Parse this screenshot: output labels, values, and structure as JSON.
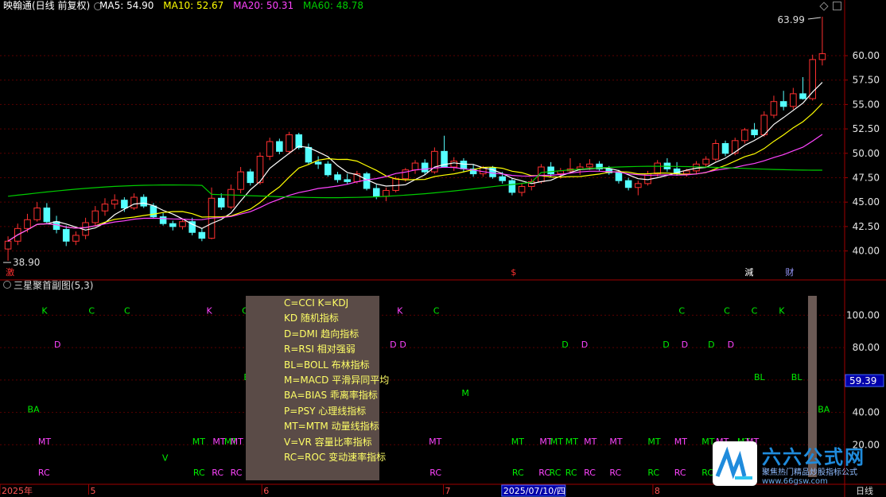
{
  "header": {
    "title": "映翰通(日线 前复权)",
    "ma5": "MA5: 54.90",
    "ma10": "MA10: 52.67",
    "ma20": "MA20: 50.31",
    "ma60": "MA60: 48.78"
  },
  "colors": {
    "up": "#ff3030",
    "down": "#55ffff",
    "ma5": "#ffffff",
    "ma10": "#ffff00",
    "ma20": "#ff44ff",
    "ma60": "#00cc00",
    "grid": "#5a0000",
    "axis": "#a00000",
    "signal_green": "#00ee00",
    "signal_magenta": "#ff44ff"
  },
  "sub_panel": {
    "title": "三星聚首副图(5,3)"
  },
  "chart_data": {
    "type": "candlestick",
    "main_axis": {
      "ticks": [
        "60.00",
        "57.50",
        "55.00",
        "52.50",
        "50.00",
        "47.50",
        "45.00",
        "42.50",
        "40.00"
      ],
      "ylim": [
        38.5,
        63.99
      ]
    },
    "sub_axis": {
      "ticks": [
        "100.00",
        "80.00",
        "60.00",
        "40.00",
        "20.00"
      ],
      "current_value": "59.39"
    },
    "high_marker": "63.99",
    "low_marker": "38.90",
    "x_labels": [
      {
        "label": "2025年",
        "pos": 0.0
      },
      {
        "label": "5",
        "pos": 0.105
      },
      {
        "label": "6",
        "pos": 0.31
      },
      {
        "label": "7",
        "pos": 0.525
      },
      {
        "label": "2025/07/10/四",
        "pos": 0.594,
        "highlight": true
      },
      {
        "label": "8",
        "pos": 0.773
      }
    ],
    "x_axis_right_label": "日线",
    "event_marks": [
      {
        "label": "激",
        "pos": 0.003,
        "color": "#ff3030"
      },
      {
        "label": "$",
        "pos": 0.601,
        "color": "#ff3030"
      },
      {
        "label": "減",
        "pos": 0.878,
        "color": "#ffffff"
      },
      {
        "label": "财",
        "pos": 0.926,
        "color": "#9999ff"
      }
    ],
    "candles": [
      [
        40.2,
        41.5,
        39.0,
        41.0
      ],
      [
        41.0,
        42.8,
        40.6,
        42.3
      ],
      [
        42.3,
        43.8,
        41.9,
        43.2
      ],
      [
        43.2,
        45.0,
        43.0,
        44.4
      ],
      [
        44.4,
        44.9,
        42.8,
        43.0
      ],
      [
        43.0,
        43.6,
        41.8,
        42.2
      ],
      [
        42.2,
        42.6,
        40.5,
        41.0
      ],
      [
        41.0,
        42.0,
        40.6,
        41.6
      ],
      [
        41.6,
        43.4,
        41.2,
        42.9
      ],
      [
        42.9,
        44.6,
        42.6,
        44.1
      ],
      [
        44.1,
        45.4,
        43.6,
        44.8
      ],
      [
        44.8,
        45.8,
        44.3,
        45.2
      ],
      [
        45.2,
        45.5,
        44.0,
        44.4
      ],
      [
        44.4,
        45.9,
        44.2,
        45.5
      ],
      [
        45.5,
        45.8,
        44.4,
        44.6
      ],
      [
        44.6,
        44.9,
        43.3,
        43.5
      ],
      [
        43.5,
        43.9,
        42.6,
        42.8
      ],
      [
        42.8,
        43.1,
        42.1,
        42.5
      ],
      [
        42.5,
        43.3,
        42.2,
        43.0
      ],
      [
        43.0,
        43.4,
        41.6,
        41.9
      ],
      [
        41.9,
        42.3,
        41.0,
        41.3
      ],
      [
        41.3,
        46.5,
        41.2,
        45.4
      ],
      [
        45.4,
        45.9,
        44.2,
        44.5
      ],
      [
        44.5,
        46.8,
        44.3,
        46.3
      ],
      [
        46.3,
        48.6,
        45.9,
        48.1
      ],
      [
        48.1,
        48.4,
        46.7,
        47.0
      ],
      [
        47.0,
        50.1,
        46.8,
        49.7
      ],
      [
        49.7,
        51.6,
        49.3,
        51.2
      ],
      [
        51.2,
        51.5,
        49.9,
        50.2
      ],
      [
        50.2,
        52.2,
        49.9,
        51.9
      ],
      [
        51.9,
        52.1,
        50.4,
        50.6
      ],
      [
        50.6,
        51.0,
        48.8,
        49.1
      ],
      [
        49.1,
        49.7,
        48.4,
        48.9
      ],
      [
        48.9,
        49.2,
        47.6,
        47.8
      ],
      [
        47.8,
        48.1,
        47.0,
        47.3
      ],
      [
        47.3,
        47.9,
        46.8,
        47.1
      ],
      [
        47.1,
        48.2,
        46.9,
        47.9
      ],
      [
        47.9,
        48.1,
        46.2,
        46.4
      ],
      [
        46.4,
        46.8,
        45.3,
        45.6
      ],
      [
        45.6,
        46.5,
        45.1,
        46.2
      ],
      [
        46.2,
        47.6,
        46.0,
        47.4
      ],
      [
        47.4,
        48.5,
        47.1,
        48.3
      ],
      [
        48.3,
        49.3,
        47.9,
        49.0
      ],
      [
        49.0,
        49.4,
        47.8,
        48.1
      ],
      [
        48.1,
        50.6,
        47.9,
        50.2
      ],
      [
        50.2,
        51.8,
        49.9,
        48.6
      ],
      [
        48.6,
        49.6,
        48.2,
        49.2
      ],
      [
        49.2,
        49.5,
        48.1,
        48.4
      ],
      [
        48.4,
        48.9,
        47.6,
        47.9
      ],
      [
        47.9,
        48.7,
        47.6,
        48.5
      ],
      [
        48.5,
        48.7,
        47.4,
        47.6
      ],
      [
        47.6,
        48.1,
        46.9,
        47.2
      ],
      [
        47.2,
        47.5,
        45.7,
        46.0
      ],
      [
        46.0,
        46.9,
        45.6,
        46.6
      ],
      [
        46.6,
        47.4,
        46.2,
        47.1
      ],
      [
        47.1,
        48.9,
        46.9,
        48.6
      ],
      [
        48.6,
        49.1,
        47.6,
        47.9
      ],
      [
        47.9,
        48.5,
        47.4,
        48.2
      ],
      [
        48.2,
        49.5,
        47.9,
        48.4
      ],
      [
        48.4,
        49.0,
        47.8,
        48.6
      ],
      [
        48.6,
        49.4,
        48.3,
        48.9
      ],
      [
        48.9,
        49.2,
        48.2,
        48.4
      ],
      [
        48.4,
        48.7,
        47.8,
        48.0
      ],
      [
        48.0,
        48.3,
        46.9,
        47.2
      ],
      [
        47.2,
        47.5,
        46.2,
        46.5
      ],
      [
        46.5,
        47.2,
        45.7,
        46.9
      ],
      [
        46.9,
        48.2,
        46.7,
        47.9
      ],
      [
        47.9,
        49.3,
        47.6,
        49.0
      ],
      [
        49.0,
        49.5,
        48.1,
        48.4
      ],
      [
        48.4,
        49.1,
        47.7,
        47.9
      ],
      [
        47.9,
        48.4,
        47.6,
        48.2
      ],
      [
        48.2,
        49.2,
        47.9,
        48.9
      ],
      [
        48.9,
        49.7,
        48.6,
        49.4
      ],
      [
        49.4,
        51.4,
        49.2,
        51.0
      ],
      [
        51.0,
        51.3,
        49.7,
        50.0
      ],
      [
        50.0,
        51.6,
        49.8,
        51.3
      ],
      [
        51.3,
        52.6,
        51.0,
        52.4
      ],
      [
        52.4,
        53.1,
        51.6,
        51.9
      ],
      [
        51.9,
        54.3,
        51.7,
        53.9
      ],
      [
        53.9,
        55.9,
        53.6,
        55.3
      ],
      [
        55.3,
        56.4,
        54.4,
        54.8
      ],
      [
        54.8,
        56.7,
        54.5,
        56.1
      ],
      [
        56.1,
        57.8,
        55.5,
        55.6
      ],
      [
        55.6,
        60.1,
        55.4,
        59.6
      ],
      [
        59.6,
        63.99,
        59.0,
        60.2
      ]
    ],
    "sub_signals": [
      {
        "label": "K",
        "x": 0.047,
        "level": 103,
        "color": "green"
      },
      {
        "label": "C",
        "x": 0.1,
        "level": 103,
        "color": "green"
      },
      {
        "label": "C",
        "x": 0.14,
        "level": 103,
        "color": "green"
      },
      {
        "label": "K",
        "x": 0.233,
        "level": 103,
        "color": "magenta"
      },
      {
        "label": "C",
        "x": 0.273,
        "level": 103,
        "color": "green"
      },
      {
        "label": "K",
        "x": 0.448,
        "level": 103,
        "color": "magenta"
      },
      {
        "label": "C",
        "x": 0.489,
        "level": 103,
        "color": "green"
      },
      {
        "label": "C",
        "x": 0.766,
        "level": 103,
        "color": "green"
      },
      {
        "label": "C",
        "x": 0.817,
        "level": 103,
        "color": "green"
      },
      {
        "label": "C",
        "x": 0.848,
        "level": 103,
        "color": "green"
      },
      {
        "label": "K",
        "x": 0.879,
        "level": 103,
        "color": "green"
      },
      {
        "label": "D",
        "x": 0.061,
        "level": 82,
        "color": "magenta"
      },
      {
        "label": "D",
        "x": 0.44,
        "level": 82,
        "color": "magenta"
      },
      {
        "label": "D",
        "x": 0.451,
        "level": 82,
        "color": "magenta"
      },
      {
        "label": "D",
        "x": 0.634,
        "level": 82,
        "color": "green"
      },
      {
        "label": "D",
        "x": 0.656,
        "level": 82,
        "color": "magenta"
      },
      {
        "label": "D",
        "x": 0.748,
        "level": 82,
        "color": "green"
      },
      {
        "label": "D",
        "x": 0.769,
        "level": 82,
        "color": "magenta"
      },
      {
        "label": "D",
        "x": 0.799,
        "level": 82,
        "color": "green"
      },
      {
        "label": "D",
        "x": 0.821,
        "level": 82,
        "color": "magenta"
      },
      {
        "label": "B",
        "x": 0.275,
        "level": 62,
        "color": "green"
      },
      {
        "label": "BL",
        "x": 0.851,
        "level": 62,
        "color": "green"
      },
      {
        "label": "BL",
        "x": 0.893,
        "level": 62,
        "color": "green"
      },
      {
        "label": "M",
        "x": 0.521,
        "level": 52,
        "color": "green"
      },
      {
        "label": "BA",
        "x": 0.031,
        "level": 42,
        "color": "green"
      },
      {
        "label": "BA",
        "x": 0.923,
        "level": 42,
        "color": "green"
      },
      {
        "label": "MT",
        "x": 0.043,
        "level": 22,
        "color": "magenta"
      },
      {
        "label": "MT",
        "x": 0.217,
        "level": 22,
        "color": "green"
      },
      {
        "label": "MT",
        "x": 0.24,
        "level": 22,
        "color": "magenta"
      },
      {
        "label": "MT",
        "x": 0.253,
        "level": 22,
        "color": "green"
      },
      {
        "label": "MT",
        "x": 0.26,
        "level": 22,
        "color": "magenta"
      },
      {
        "label": "MT",
        "x": 0.484,
        "level": 22,
        "color": "magenta"
      },
      {
        "label": "MT",
        "x": 0.577,
        "level": 22,
        "color": "green"
      },
      {
        "label": "MT",
        "x": 0.609,
        "level": 22,
        "color": "magenta"
      },
      {
        "label": "MT",
        "x": 0.621,
        "level": 22,
        "color": "green"
      },
      {
        "label": "MT",
        "x": 0.638,
        "level": 22,
        "color": "green"
      },
      {
        "label": "MT",
        "x": 0.659,
        "level": 22,
        "color": "magenta"
      },
      {
        "label": "MT",
        "x": 0.688,
        "level": 22,
        "color": "magenta"
      },
      {
        "label": "MT",
        "x": 0.731,
        "level": 22,
        "color": "green"
      },
      {
        "label": "MT",
        "x": 0.761,
        "level": 22,
        "color": "magenta"
      },
      {
        "label": "MT",
        "x": 0.792,
        "level": 22,
        "color": "green"
      },
      {
        "label": "MT",
        "x": 0.808,
        "level": 22,
        "color": "magenta"
      },
      {
        "label": "MT",
        "x": 0.832,
        "level": 22,
        "color": "green"
      },
      {
        "label": "MT",
        "x": 0.842,
        "level": 22,
        "color": "magenta"
      },
      {
        "label": "V",
        "x": 0.183,
        "level": 12,
        "color": "green"
      },
      {
        "label": "RC",
        "x": 0.043,
        "level": 3,
        "color": "magenta"
      },
      {
        "label": "RC",
        "x": 0.218,
        "level": 3,
        "color": "green"
      },
      {
        "label": "RC",
        "x": 0.239,
        "level": 3,
        "color": "magenta"
      },
      {
        "label": "RC",
        "x": 0.26,
        "level": 3,
        "color": "magenta"
      },
      {
        "label": "RC",
        "x": 0.485,
        "level": 3,
        "color": "magenta"
      },
      {
        "label": "RC",
        "x": 0.578,
        "level": 3,
        "color": "green"
      },
      {
        "label": "RC",
        "x": 0.608,
        "level": 3,
        "color": "magenta"
      },
      {
        "label": "RC",
        "x": 0.62,
        "level": 3,
        "color": "green"
      },
      {
        "label": "RC",
        "x": 0.638,
        "level": 3,
        "color": "green"
      },
      {
        "label": "RC",
        "x": 0.659,
        "level": 3,
        "color": "magenta"
      },
      {
        "label": "RC",
        "x": 0.688,
        "level": 3,
        "color": "magenta"
      },
      {
        "label": "RC",
        "x": 0.731,
        "level": 3,
        "color": "green"
      },
      {
        "label": "RC",
        "x": 0.761,
        "level": 3,
        "color": "magenta"
      },
      {
        "label": "RC",
        "x": 0.792,
        "level": 3,
        "color": "green"
      },
      {
        "label": "RC",
        "x": 0.833,
        "level": 3,
        "color": "magenta"
      }
    ],
    "sub_volume_bar": {
      "x": 0.912,
      "top": 112,
      "bottom": 0
    }
  },
  "infobox": {
    "lines": [
      "C=CCI    K=KDJ",
      "KD  随机指标",
      "D=DMI  趋向指标",
      "R=RSI  相对强弱",
      "BL=BOLL  布林指标",
      "M=MACD  平滑异同平均",
      "BA=BIAS   乖离率指标",
      "P=PSY   心理线指标",
      "MT=MTM  动量线指标",
      "V=VR  容量比率指标",
      "RC=ROC  变动速率指标"
    ]
  },
  "watermark": {
    "title": "六六公式网",
    "subtitle": "聚焦热门精品炒股指标公式",
    "url": "www.66gsw.com"
  }
}
